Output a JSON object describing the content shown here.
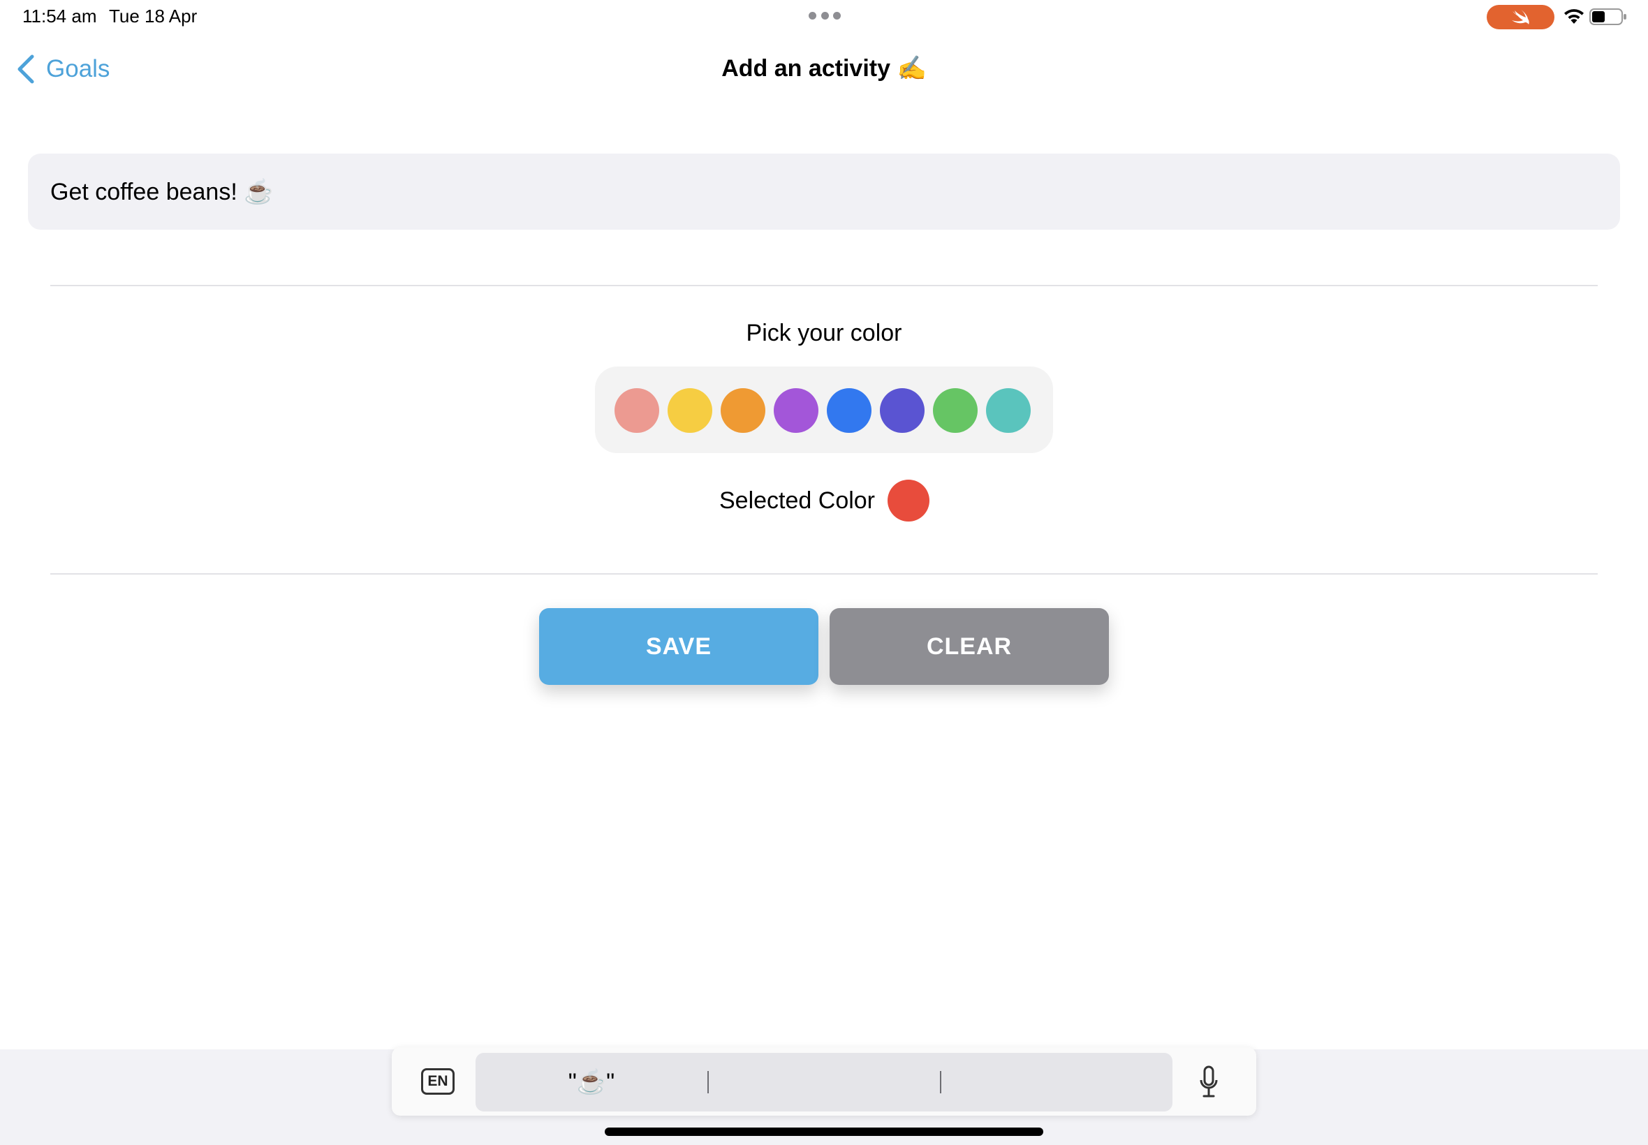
{
  "status_bar": {
    "time": "11:54 am",
    "date": "Tue 18 Apr",
    "record_pill_color": "#e2632f"
  },
  "nav": {
    "back_label": "Goals",
    "title": "Add an activity ✍️",
    "accent_color": "#4da2d9"
  },
  "activity_field": {
    "value": "Get coffee beans! ☕️"
  },
  "color_picker": {
    "title": "Pick your color",
    "swatches": [
      "#ec9a91",
      "#f6cd42",
      "#ef9a33",
      "#a356d9",
      "#3278ef",
      "#5a54d2",
      "#66c564",
      "#5ac4bd"
    ],
    "selected_label": "Selected Color",
    "selected_color": "#e84c3c"
  },
  "buttons": {
    "save_label": "SAVE",
    "save_color": "#57ace2",
    "clear_label": "CLEAR",
    "clear_color": "#8e8e93"
  },
  "keyboard_bar": {
    "language": "EN",
    "suggestions": [
      "\"☕️\"",
      "",
      ""
    ]
  }
}
